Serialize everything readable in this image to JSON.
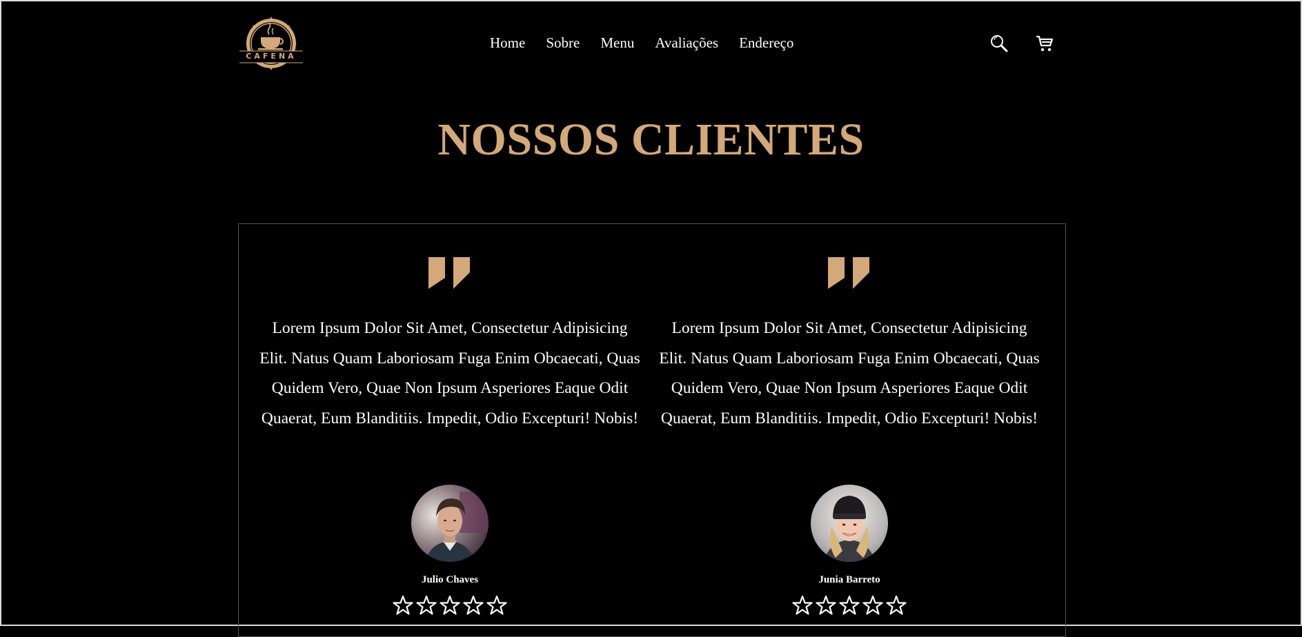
{
  "brand": {
    "logo_text": "CAFENA",
    "accent_color": "#d3a87a"
  },
  "nav": {
    "items": [
      {
        "label": "Home"
      },
      {
        "label": "Sobre"
      },
      {
        "label": "Menu"
      },
      {
        "label": "Avaliações"
      },
      {
        "label": "Endereço"
      }
    ]
  },
  "header_icons": [
    "search-icon",
    "cart-icon"
  ],
  "section": {
    "title": "NOSSOS CLIENTES"
  },
  "reviews": [
    {
      "text": "Lorem Ipsum Dolor Sit Amet, Consectetur Adipisicing Elit. Natus Quam Laboriosam Fuga Enim Obcaecati, Quas Quidem Vero, Quae Non Ipsum Asperiores Eaque Odit Quaerat, Eum Blanditiis. Impedit, Odio Excepturi! Nobis!",
      "name": "Julio Chaves",
      "rating_max": 5
    },
    {
      "text": "Lorem Ipsum Dolor Sit Amet, Consectetur Adipisicing Elit. Natus Quam Laboriosam Fuga Enim Obcaecati, Quas Quidem Vero, Quae Non Ipsum Asperiores Eaque Odit Quaerat, Eum Blanditiis. Impedit, Odio Excepturi! Nobis!",
      "name": "Junia Barreto",
      "rating_max": 5
    }
  ]
}
